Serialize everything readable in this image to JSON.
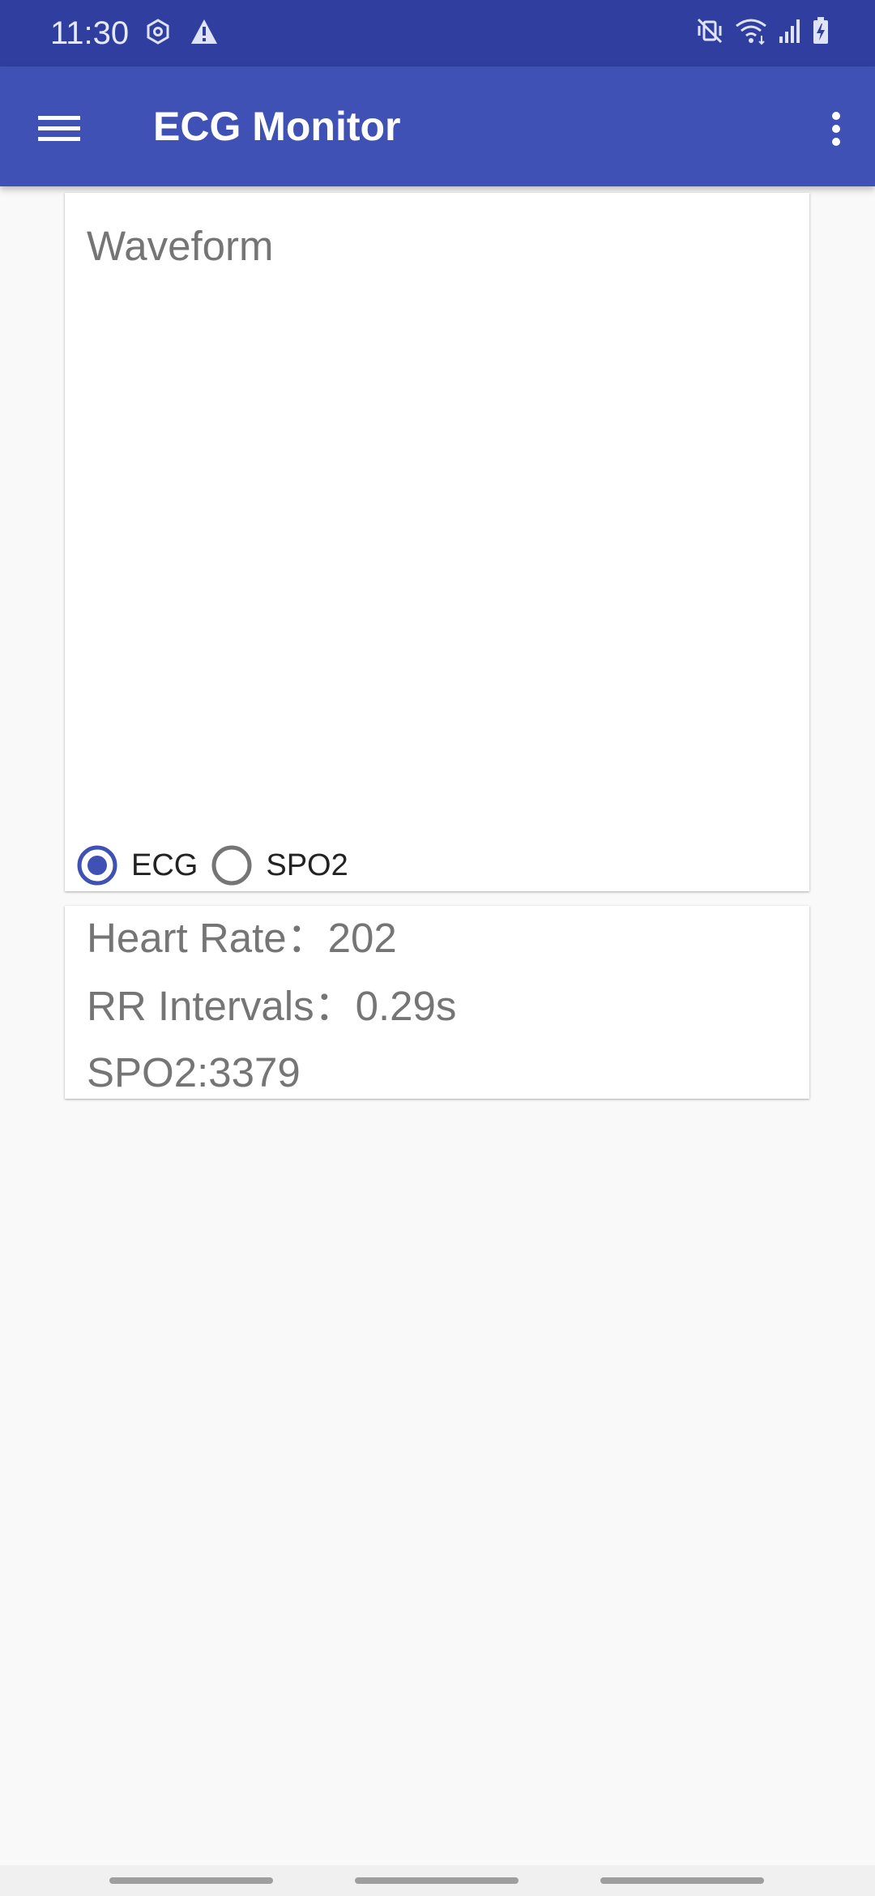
{
  "status_bar": {
    "time": "11:30",
    "left_icons": [
      "hexagon-settings-icon",
      "warning-icon"
    ],
    "right_icons": [
      "mute-vibrate-icon",
      "wifi-icon",
      "signal-icon",
      "battery-charging-icon"
    ],
    "bg_color": "#303f9f"
  },
  "app_bar": {
    "title": "ECG Monitor",
    "menu_icon": "hamburger-menu-icon",
    "overflow_icon": "more-vert-icon",
    "bg_color": "#3f51b5"
  },
  "waveform_card": {
    "title": "Waveform",
    "radio_options": [
      {
        "label": "ECG",
        "selected": true
      },
      {
        "label": "SPO2",
        "selected": false
      }
    ],
    "accent_color": "#3f51b5"
  },
  "stats_card": {
    "heart_rate": "Heart Rate：202",
    "rr_intervals": "RR Intervals：0.29s",
    "spo2": "SPO2:3379"
  },
  "nav_bar": {
    "handles": 3
  }
}
